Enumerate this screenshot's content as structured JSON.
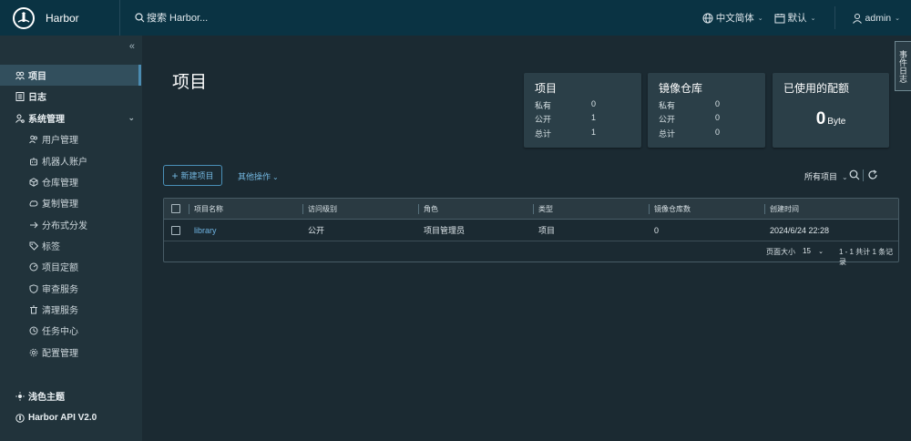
{
  "header": {
    "app_name": "Harbor",
    "search_placeholder": "搜索 Harbor...",
    "language": "中文简体",
    "date_format": "默认",
    "user": "admin"
  },
  "sidebar": {
    "items": [
      {
        "label": "项目",
        "icon": "projects-icon",
        "active": true
      },
      {
        "label": "日志",
        "icon": "logs-icon"
      },
      {
        "label": "系统管理",
        "icon": "admin-icon",
        "expanded": true
      }
    ],
    "sub_items": [
      {
        "label": "用户管理",
        "icon": "users-icon"
      },
      {
        "label": "机器人账户",
        "icon": "robot-icon"
      },
      {
        "label": "仓库管理",
        "icon": "registry-icon"
      },
      {
        "label": "复制管理",
        "icon": "replication-icon"
      },
      {
        "label": "分布式分发",
        "icon": "distribution-icon"
      },
      {
        "label": "标签",
        "icon": "tag-icon"
      },
      {
        "label": "项目定额",
        "icon": "quota-icon"
      },
      {
        "label": "审查服务",
        "icon": "shield-icon"
      },
      {
        "label": "清理服务",
        "icon": "trash-icon"
      },
      {
        "label": "任务中心",
        "icon": "task-icon"
      },
      {
        "label": "配置管理",
        "icon": "gear-icon"
      }
    ],
    "theme_toggle": "浅色主题",
    "api_link": "Harbor API V2.0"
  },
  "event_log_tab": "事件日志",
  "main": {
    "title": "项目",
    "cards": {
      "projects": {
        "title": "项目",
        "rows": [
          {
            "label": "私有",
            "value": "0"
          },
          {
            "label": "公开",
            "value": "1"
          },
          {
            "label": "总计",
            "value": "1"
          }
        ]
      },
      "repositories": {
        "title": "镜像仓库",
        "rows": [
          {
            "label": "私有",
            "value": "0"
          },
          {
            "label": "公开",
            "value": "0"
          },
          {
            "label": "总计",
            "value": "0"
          }
        ]
      },
      "storage": {
        "title": "已使用的配额",
        "value": "0",
        "unit": "Byte"
      }
    },
    "new_project_button": "新建项目",
    "more_actions": "其他操作",
    "filter": "所有项目",
    "table": {
      "columns": [
        "项目名称",
        "访问级别",
        "角色",
        "类型",
        "镜像仓库数",
        "创建时间"
      ],
      "rows": [
        {
          "name": "library",
          "access": "公开",
          "role": "项目管理员",
          "type": "项目",
          "repo_count": "0",
          "created": "2024/6/24 22:28"
        }
      ],
      "page_size_label": "页面大小",
      "page_size": "15",
      "total": "1 - 1 共计 1 条记录"
    }
  },
  "colors": {
    "header_bg": "#0a3343",
    "sidebar_bg": "#21333b",
    "main_bg": "#1b2a32",
    "card_bg": "#2b3f48",
    "link": "#6fb4e3"
  }
}
